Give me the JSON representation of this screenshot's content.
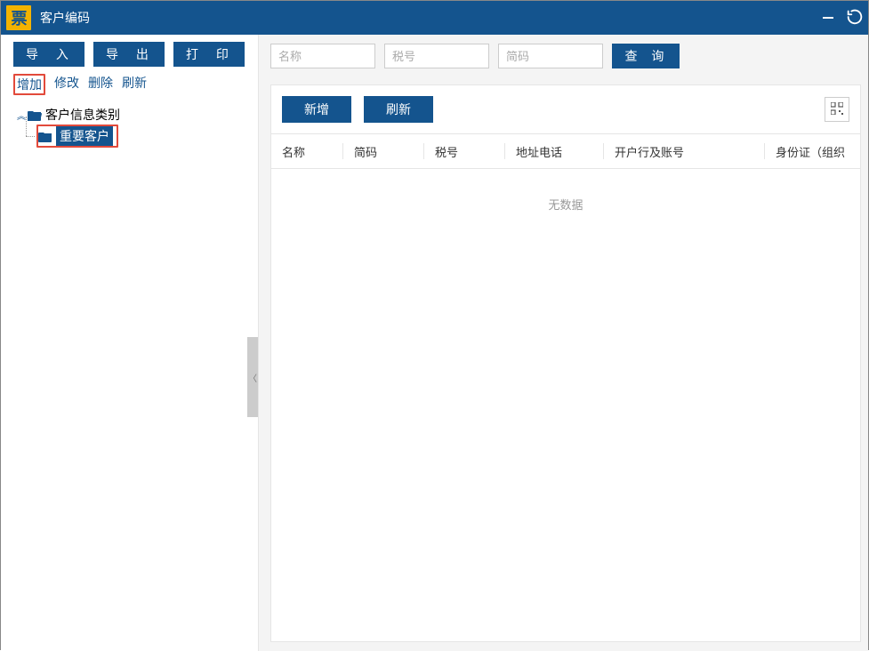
{
  "titlebar": {
    "title": "客户编码",
    "logo_text": "票"
  },
  "sidebar": {
    "buttons": {
      "import": "导 入",
      "export": "导 出",
      "print": "打 印"
    },
    "actions": {
      "add": "增加",
      "modify": "修改",
      "delete": "删除",
      "refresh": "刷新"
    },
    "tree": {
      "root": {
        "label": "客户信息类别",
        "expanded": true
      },
      "child": {
        "label": "重要客户",
        "selected": true
      }
    }
  },
  "search": {
    "name_ph": "名称",
    "taxno_ph": "税号",
    "code_ph": "简码",
    "query": "查 询"
  },
  "ops": {
    "new": "新增",
    "refresh": "刷新"
  },
  "table": {
    "cols": {
      "name": "名称",
      "code": "简码",
      "taxno": "税号",
      "addrtel": "地址电话",
      "bankacct": "开户行及账号",
      "idorg": "身份证（组织"
    },
    "empty": "无数据"
  }
}
